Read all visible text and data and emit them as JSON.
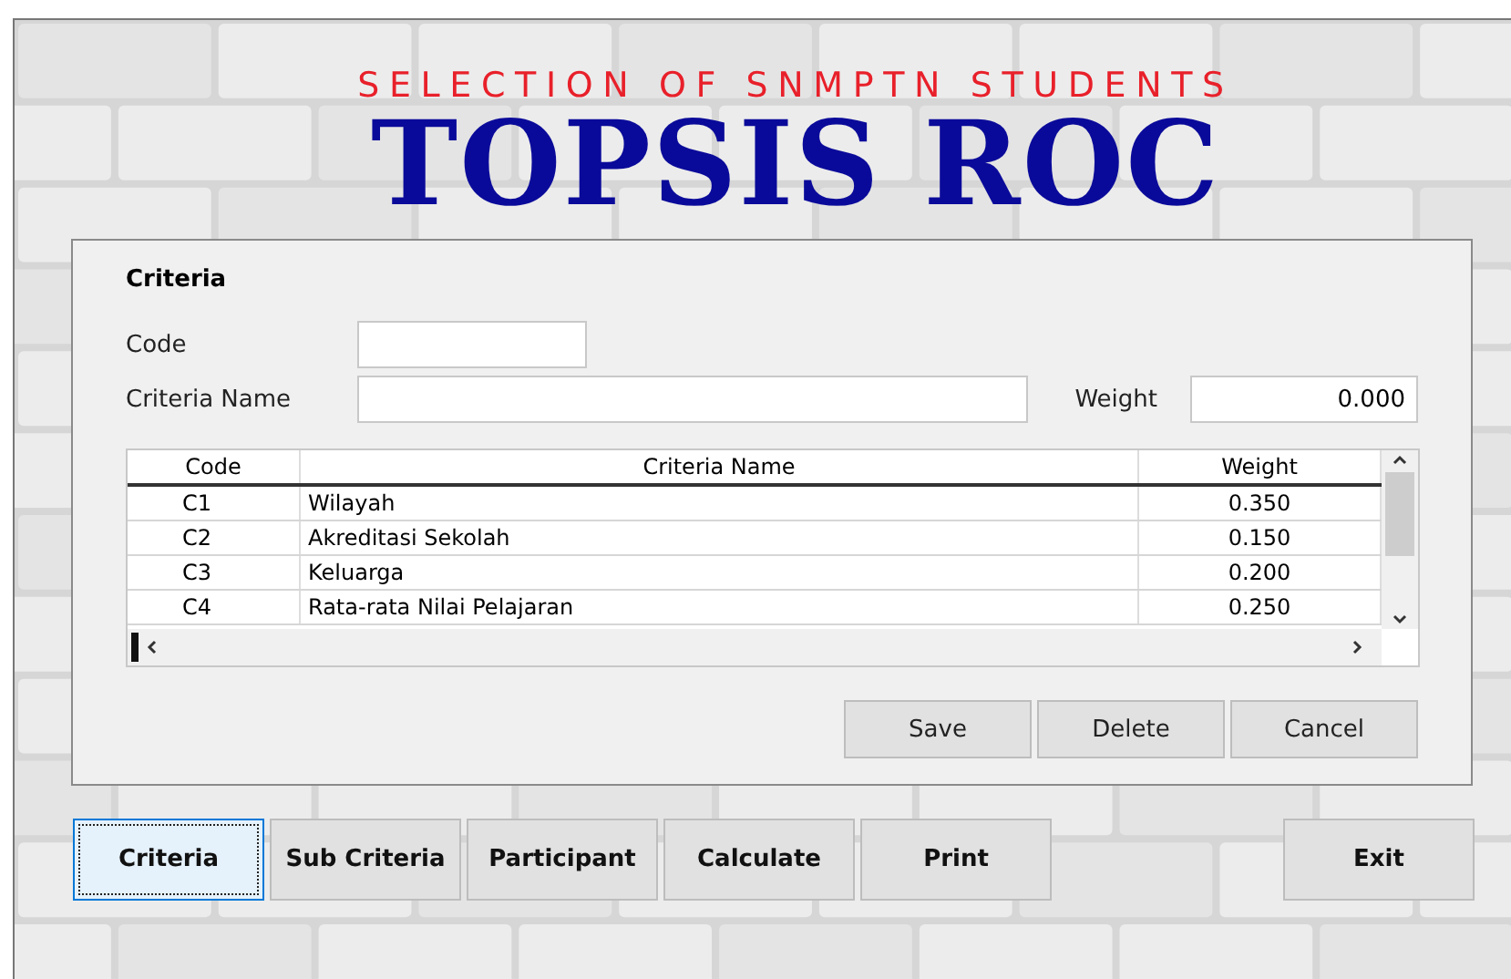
{
  "header": {
    "subtitle": "SELECTION OF SNMPTN STUDENTS",
    "title": "TOPSIS ROC"
  },
  "form": {
    "section_title": "Criteria",
    "code": {
      "label": "Code"
    },
    "criteria_name": {
      "label": "Criteria Name"
    },
    "weight": {
      "label": "Weight",
      "value": "0.000"
    }
  },
  "table": {
    "columns": [
      "Code",
      "Criteria Name",
      "Weight"
    ],
    "rows": [
      {
        "code": "C1",
        "name": "Wilayah",
        "weight": "0.350"
      },
      {
        "code": "C2",
        "name": "Akreditasi Sekolah",
        "weight": "0.150"
      },
      {
        "code": "C3",
        "name": "Keluarga",
        "weight": "0.200"
      },
      {
        "code": "C4",
        "name": "Rata-rata Nilai Pelajaran",
        "weight": "0.250"
      }
    ]
  },
  "actions": [
    "Save",
    "Delete",
    "Cancel"
  ],
  "nav": [
    {
      "label": "Criteria",
      "selected": true
    },
    {
      "label": "Sub Criteria",
      "selected": false
    },
    {
      "label": "Participant",
      "selected": false
    },
    {
      "label": "Calculate",
      "selected": false
    },
    {
      "label": "Print",
      "selected": false
    }
  ],
  "exit": "Exit"
}
